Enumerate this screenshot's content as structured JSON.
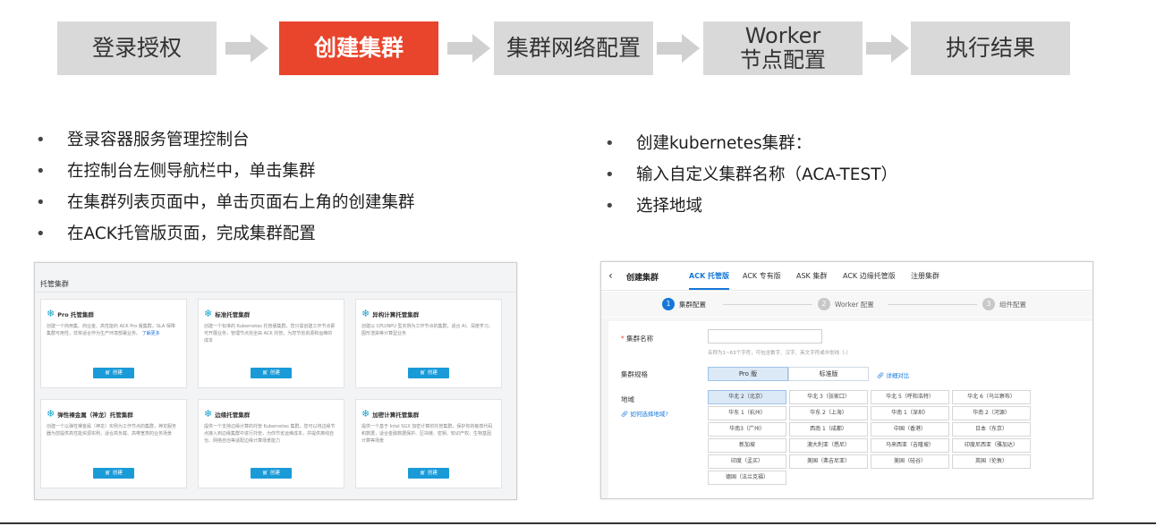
{
  "flow": {
    "steps": [
      {
        "label": "登录授权",
        "active": false
      },
      {
        "label": "创建集群",
        "active": true
      },
      {
        "label": "集群网络配置",
        "active": false
      },
      {
        "line1": "Worker",
        "line2": "节点配置",
        "active": false
      },
      {
        "label": "执行结果",
        "active": false
      }
    ],
    "arrow_icon": "arrow-right-icon",
    "colors": {
      "active": "#e8452c",
      "inactive": "#d9d9d9"
    }
  },
  "left_bullets": [
    "登录容器服务管理控制台",
    "在控制台左侧导航栏中，单击集群",
    "在集群列表页面中，单击页面右上角的创建集群",
    "在ACK托管版页面，完成集群配置"
  ],
  "right_bullets": [
    "创建kubernetes集群：",
    "输入自定义集群名称（ACA-TEST）",
    "选择地域"
  ],
  "bullet_glyph": "•",
  "managed_panel": {
    "title": "托管集群",
    "cards": [
      {
        "name": "Pro 托管集群",
        "desc": "创建一个商用集、商业金、高性能的 ACK Pro 版集群，SLA 保障集群可用性，非常适合作为生产环境部署业务。",
        "more": "了解更多",
        "button": "创建"
      },
      {
        "name": "标准托管集群",
        "desc": "创建一个标准的 Kubernetes 托管版集群，您只需创建工作节点即可开展业务，管理节点完全由 ACK 托管，为您节省资源和运维的成本",
        "more": "",
        "button": "创建"
      },
      {
        "name": "异构计算托管集群",
        "desc": "创建以 CPU/NPU 型实例为工作节点的集群，适合 AI、深度学习、图形渲染等计算型业务",
        "more": "",
        "button": "创建"
      },
      {
        "name": "弹性裸金属（神龙）托管集群",
        "desc": "创建一个以弹性裸金属（神龙）实例为工作节点的集群，神龙服务器为您提供高性能资源实例，适合高负载、高带宽类的业务场景",
        "more": "",
        "button": "创建"
      },
      {
        "name": "边缘托管集群",
        "desc": "提供一个支持边缘计算的托管 Kubernetes 集群，您可以将边缘节点接入到边缘集群中进行托管，为你节省运维成本，并提供离线自治、网络自治等适配边缘计算场景能力",
        "more": "",
        "button": "创建"
      },
      {
        "name": "加密计算托管集群",
        "desc": "提供一个基于 Intel SGX 加密计算的托管集群，保护你的敏感代码和数据，适合金融数据保护、区块链、密钥、知识产权、生物基因计算等场景",
        "more": "",
        "button": "创建"
      }
    ],
    "icon": "snowflake-icon",
    "accent": "#1a9bd8"
  },
  "create_panel": {
    "back_icon": "chevron-left-icon",
    "back_glyph": "‹",
    "title": "创建集群",
    "tabs": [
      "ACK 托管版",
      "ACK 专有版",
      "ASK 集群",
      "ACK 边缘托管版",
      "注册集群"
    ],
    "steps": [
      {
        "num": "1",
        "label": "集群配置"
      },
      {
        "num": "2",
        "label": "Worker 配置"
      },
      {
        "num": "3",
        "label": "组件配置"
      }
    ],
    "name_label": "集群名称",
    "required_mark": "*",
    "name_value": "",
    "name_hint": "名称为1~63个字符，可包含数字、汉字、英文字符或中划线（-）",
    "spec_label": "集群规格",
    "spec_options": [
      "Pro 版",
      "标准版"
    ],
    "spec_link": "详细对比",
    "link_icon": "link-icon",
    "region_label": "地域",
    "region_help": "如何选择地域?",
    "regions": [
      "华北 2（北京）",
      "华北 3（张家口）",
      "华北 5（呼和浩特）",
      "华北 6（乌兰察布）",
      "华东 1（杭州）",
      "华东 2（上海）",
      "华南 1（深圳）",
      "华南 2（河源）",
      "华南3（广州）",
      "西南 1（成都）",
      "中国（香港）",
      "日本（东京）",
      "新加坡",
      "澳大利亚（悉尼）",
      "马来西亚（吉隆坡）",
      "印度尼西亚（雅加达）",
      "印度（孟买）",
      "美国（弗吉尼亚）",
      "美国（硅谷）",
      "英国（伦敦）",
      "德国（法兰克福）"
    ],
    "accent": "#1677d8"
  }
}
